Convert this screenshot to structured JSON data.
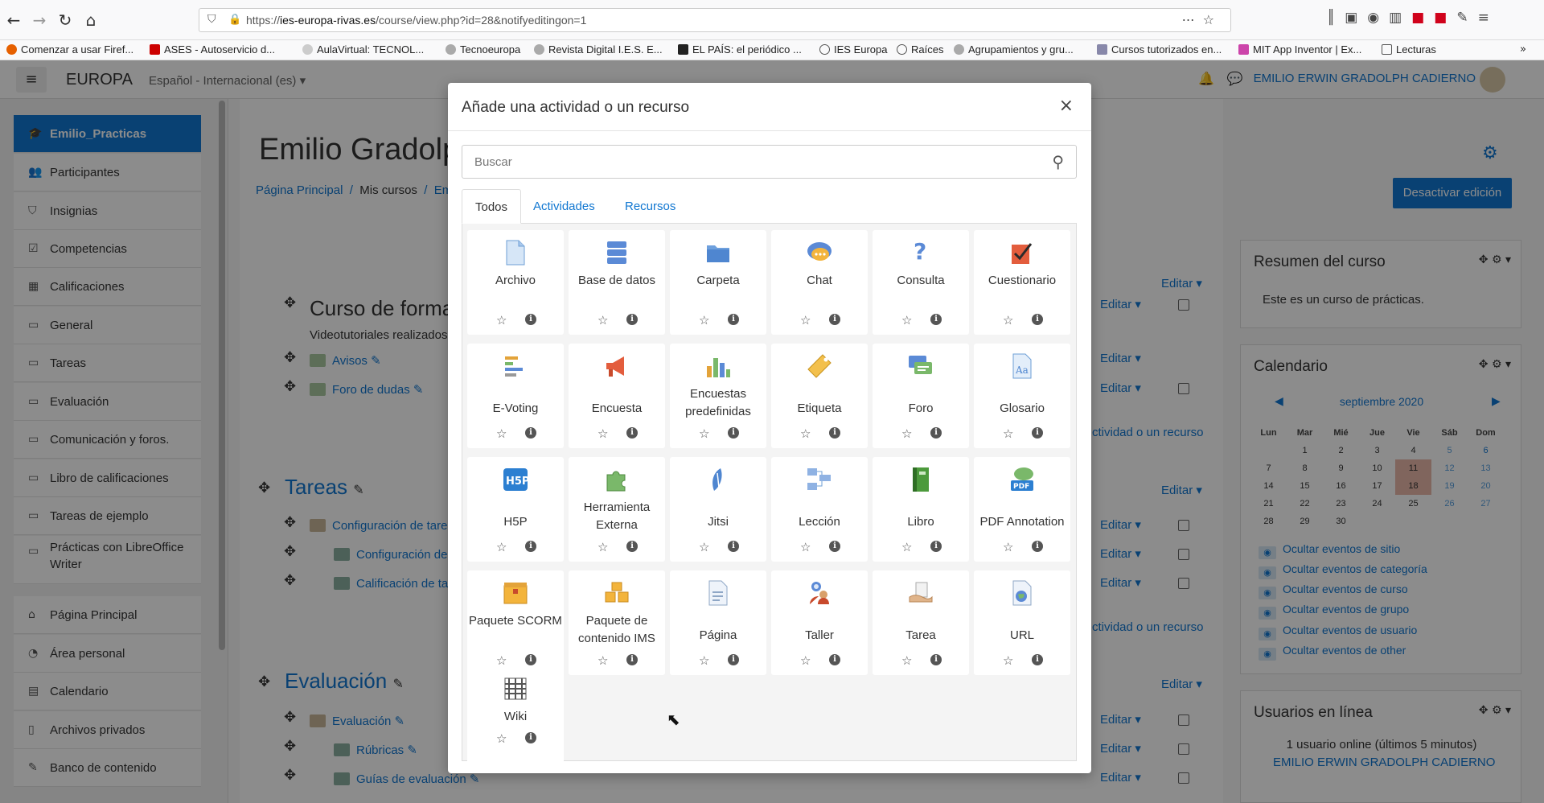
{
  "browser": {
    "url_prefix": "https://",
    "url_domain": "ies-europa-rivas.es",
    "url_path": "/course/view.php?id=28&notifyeditingon=1",
    "bookmarks": [
      "Comenzar a usar Firef...",
      "ASES - Autoservicio d...",
      "AulaVirtual: TECNOL...",
      "Tecnoeuropa",
      "Revista Digital I.E.S. E...",
      "EL PAÍS: el periódico ...",
      "IES Europa",
      "Raíces",
      "Agrupamientos y gru...",
      "Cursos tutorizados en...",
      "MIT App Inventor | Ex...",
      "Lecturas"
    ]
  },
  "navbar": {
    "brand": "EUROPA",
    "language": "Español - Internacional (es) ▾",
    "user": "EMILIO ERWIN GRADOLPH CADIERNO"
  },
  "drawer": {
    "items": [
      "Emilio_Practicas",
      "Participantes",
      "Insignias",
      "Competencias",
      "Calificaciones",
      "General",
      "Tareas",
      "Evaluación",
      "Comunicación y foros.",
      "Libro de calificaciones",
      "Tareas de ejemplo",
      "Prácticas con LibreOffice Writer",
      "Página Principal",
      "Área personal",
      "Calendario",
      "Archivos privados",
      "Banco de contenido"
    ]
  },
  "main": {
    "title": "Emilio Gradolp",
    "breadcrumb": [
      "Página Principal",
      "Mis cursos",
      "Em"
    ],
    "disable_edit": "Desactivar edición",
    "section0_title": "Curso de forma",
    "section0_text": "Videotutoriales realizados",
    "section0_items": [
      "Avisos",
      "Foro de dudas"
    ],
    "section1_title": "Tareas",
    "section1_items": [
      "Configuración de tare",
      "Configuración de",
      "Calificación de ta"
    ],
    "section2_title": "Evaluación",
    "section2_items": [
      "Evaluación",
      "Rúbricas",
      "Guías de evaluación"
    ],
    "edit_label": "Editar ▾",
    "add_activity_partial": "ctividad o un recurso"
  },
  "blocks": {
    "summary_title": "Resumen del curso",
    "summary_text": "Este es un curso de prácticas.",
    "calendar_title": "Calendario",
    "calendar_month": "septiembre 2020",
    "calendar_days": [
      "Lun",
      "Mar",
      "Mié",
      "Jue",
      "Vie",
      "Sáb",
      "Dom"
    ],
    "calendar_weeks": [
      [
        "",
        "1",
        "2",
        "3",
        "4",
        "5",
        "6"
      ],
      [
        "7",
        "8",
        "9",
        "10",
        "11",
        "12",
        "13"
      ],
      [
        "14",
        "15",
        "16",
        "17",
        "18",
        "19",
        "20"
      ],
      [
        "21",
        "22",
        "23",
        "24",
        "25",
        "26",
        "27"
      ],
      [
        "28",
        "29",
        "30",
        "",
        "",
        "",
        ""
      ]
    ],
    "calendar_links": [
      "Ocultar eventos de sitio",
      "Ocultar eventos de categoría",
      "Ocultar eventos de curso",
      "Ocultar eventos de grupo",
      "Ocultar eventos de usuario",
      "Ocultar eventos de other"
    ],
    "online_title": "Usuarios en línea",
    "online_text": "1 usuario online (últimos 5 minutos)",
    "online_user": "EMILIO ERWIN GRADOLPH CADIERNO"
  },
  "modal": {
    "title": "Añade una actividad o un recurso",
    "close": "×",
    "search_placeholder": "Buscar",
    "tabs": [
      "Todos",
      "Actividades",
      "Recursos"
    ],
    "items": [
      {
        "label": "Archivo",
        "icon": "file-icon"
      },
      {
        "label": "Base de datos",
        "icon": "database-icon"
      },
      {
        "label": "Carpeta",
        "icon": "folder-icon"
      },
      {
        "label": "Chat",
        "icon": "chat-icon"
      },
      {
        "label": "Consulta",
        "icon": "question-icon"
      },
      {
        "label": "Cuestionario",
        "icon": "quiz-icon"
      },
      {
        "label": "E-Voting",
        "icon": "voting-icon"
      },
      {
        "label": "Encuesta",
        "icon": "megaphone-icon"
      },
      {
        "label": "Encuestas predefinidas",
        "icon": "bar-chart-icon"
      },
      {
        "label": "Etiqueta",
        "icon": "tag-icon"
      },
      {
        "label": "Foro",
        "icon": "forum-icon"
      },
      {
        "label": "Glosario",
        "icon": "glossary-icon"
      },
      {
        "label": "H5P",
        "icon": "h5p-icon"
      },
      {
        "label": "Herramienta Externa",
        "icon": "puzzle-icon"
      },
      {
        "label": "Jitsi",
        "icon": "jitsi-icon"
      },
      {
        "label": "Lección",
        "icon": "lesson-icon"
      },
      {
        "label": "Libro",
        "icon": "book-icon"
      },
      {
        "label": "PDF Annotation",
        "icon": "pdf-icon"
      },
      {
        "label": "Paquete SCORM",
        "icon": "scorm-package-icon"
      },
      {
        "label": "Paquete de contenido IMS",
        "icon": "ims-package-icon"
      },
      {
        "label": "Página",
        "icon": "page-icon"
      },
      {
        "label": "Taller",
        "icon": "workshop-icon"
      },
      {
        "label": "Tarea",
        "icon": "assignment-icon"
      },
      {
        "label": "URL",
        "icon": "url-icon"
      },
      {
        "label": "Wiki",
        "icon": "wiki-icon"
      }
    ]
  },
  "colors": {
    "accent": "#1177d1",
    "drawer_active": "#1177d1"
  }
}
